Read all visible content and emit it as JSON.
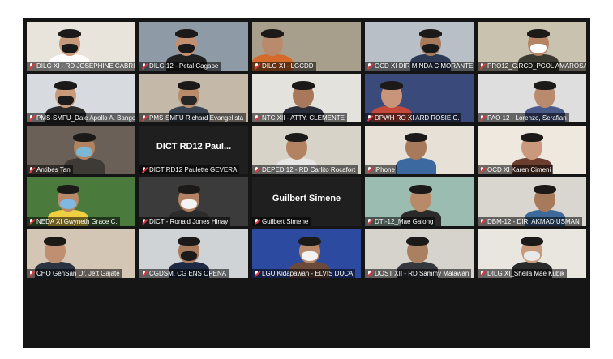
{
  "participants": [
    {
      "label": "DILG XI - RD JOSEPHINE CABRIDO",
      "active": true,
      "bg": "#e8e4dc"
    },
    {
      "label": "DILG 12 - Petal Cagape",
      "bg": "#8e9aa6"
    },
    {
      "label": "DILG XI - LGCDD",
      "bg": "#a89e8c"
    },
    {
      "label": "OCD XI DIR MINDA C MORANTE",
      "bg": "#b9bfc6"
    },
    {
      "label": "PRO12_C.RCD_PCOL AMAROSA",
      "bg": "#c9c2ae"
    },
    {
      "label": "PMS-SMFU_Dale Apollo A. Bangoy",
      "bg": "#d7dbe0"
    },
    {
      "label": "PMS-SMFU Richard Evangelista",
      "bg": "#c4b9a8"
    },
    {
      "label": "NTC XII - ATTY. CLEMENTE",
      "bg": "#e4e2dd"
    },
    {
      "label": "DPWH RO XI ARD ROSIE C.",
      "bg": "#3a4a7a"
    },
    {
      "label": "PAO 12 - Lorenzo, Serafian",
      "bg": "#dedede"
    },
    {
      "label": "Antibes Tan",
      "bg": "#6a6058"
    },
    {
      "label": "DICT RD12 Paulette GEVERA",
      "nocam": true,
      "display": "DICT RD12 Paul..."
    },
    {
      "label": "DEPED 12 - RD Carlito Rocafort",
      "bg": "#d8d3c9"
    },
    {
      "label": "iPhone",
      "bg": "#e6e0d6"
    },
    {
      "label": "OCD XI Karen Cimeni",
      "bg": "#efe8de"
    },
    {
      "label": "NEDA XI Gwyneth Grace C.",
      "bg": "#4a7a3c"
    },
    {
      "label": "DICT - Ronald Jones Hinay",
      "bg": "#3b3b3b"
    },
    {
      "label": "Guilbert Simene",
      "nocam": true,
      "display": "Guilbert Simene"
    },
    {
      "label": "DTI-12_Mae Galong",
      "bg": "#9bbcb0"
    },
    {
      "label": "DBM-12 - DIR. AKMAD USMAN",
      "bg": "#d9d6d0"
    },
    {
      "label": "CHO GenSan Dr. Jett Gajate",
      "bg": "#d4c6b4"
    },
    {
      "label": "CGDSM, CG ENS OPENA",
      "bg": "#cfd3d6"
    },
    {
      "label": "LGU Kidapawan - ELVIS DUCA",
      "bg": "#2b4aa0"
    },
    {
      "label": "DOST XII - RD Sammy Malawan",
      "bg": "#d6d2cc"
    },
    {
      "label": "DILG XI_Sheila Mae Kubik",
      "bg": "#e9e5df"
    }
  ]
}
